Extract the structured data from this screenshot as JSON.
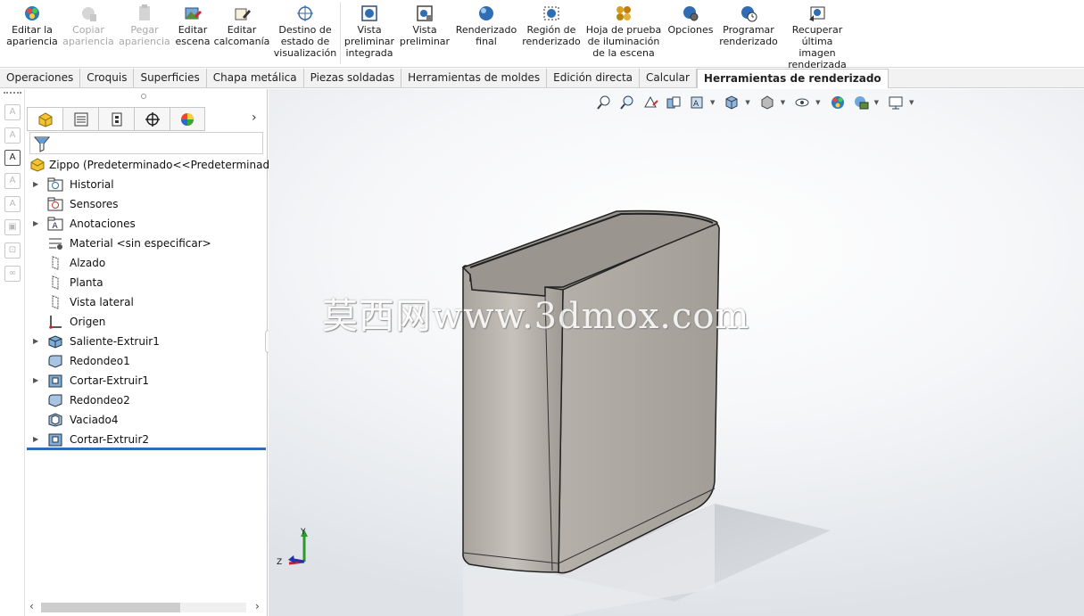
{
  "ribbon": {
    "buttons": [
      {
        "label": "Editar la\napariencia",
        "icon": "edit-appearance-icon",
        "enabled": true
      },
      {
        "label": "Copiar\napariencia",
        "icon": "copy-appearance-icon",
        "enabled": false
      },
      {
        "label": "Pegar\napariencia",
        "icon": "paste-appearance-icon",
        "enabled": false
      },
      {
        "label": "Editar\nescena",
        "icon": "edit-scene-icon",
        "enabled": true
      },
      {
        "label": "Editar\ncalcomanía",
        "icon": "edit-decal-icon",
        "enabled": true
      },
      {
        "label": "Destino de\nestado de\nvisualización",
        "icon": "display-state-target-icon",
        "enabled": true
      },
      {
        "label": "Vista\npreliminar\nintegrada",
        "icon": "integrated-preview-icon",
        "enabled": true
      },
      {
        "label": "Vista\npreliminar",
        "icon": "preview-window-icon",
        "enabled": true
      },
      {
        "label": "Renderizado\nfinal",
        "icon": "final-render-icon",
        "enabled": true
      },
      {
        "label": "Región de\nrenderizado",
        "icon": "render-region-icon",
        "enabled": true
      },
      {
        "label": "Hoja de prueba\nde iluminación\nde la escena",
        "icon": "scene-illumination-proof-sheet-icon",
        "enabled": true
      },
      {
        "label": "Opciones",
        "icon": "options-icon",
        "enabled": true
      },
      {
        "label": "Programar\nrenderizado",
        "icon": "schedule-render-icon",
        "enabled": true
      },
      {
        "label": "Recuperar\núltima imagen\nrenderizada",
        "icon": "recall-last-render-icon",
        "enabled": true
      }
    ]
  },
  "tabs": [
    {
      "label": "Operaciones",
      "active": false
    },
    {
      "label": "Croquis",
      "active": false
    },
    {
      "label": "Superficies",
      "active": false
    },
    {
      "label": "Chapa metálica",
      "active": false
    },
    {
      "label": "Piezas soldadas",
      "active": false
    },
    {
      "label": "Herramientas de moldes",
      "active": false
    },
    {
      "label": "Edición directa",
      "active": false
    },
    {
      "label": "Calcular",
      "active": false
    },
    {
      "label": "Herramientas de renderizado",
      "active": true
    }
  ],
  "panel": {
    "tabs": [
      "feature-manager-icon",
      "property-manager-icon",
      "configuration-manager-icon",
      "dimxpert-manager-icon",
      "display-manager-icon"
    ],
    "filter_icon": "filter-icon",
    "root": "Zippo  (Predeterminado<<Predeterminado>_P",
    "items": [
      {
        "label": "Historial",
        "icon": "history-folder-icon",
        "expandable": true
      },
      {
        "label": "Sensores",
        "icon": "sensors-folder-icon",
        "expandable": false
      },
      {
        "label": "Anotaciones",
        "icon": "annotations-folder-icon",
        "expandable": true
      },
      {
        "label": "Material <sin especificar>",
        "icon": "material-icon",
        "expandable": false
      },
      {
        "label": "Alzado",
        "icon": "plane-icon",
        "expandable": false
      },
      {
        "label": "Planta",
        "icon": "plane-icon",
        "expandable": false
      },
      {
        "label": "Vista lateral",
        "icon": "plane-icon",
        "expandable": false
      },
      {
        "label": "Origen",
        "icon": "origin-icon",
        "expandable": false
      },
      {
        "label": "Saliente-Extruir1",
        "icon": "boss-extrude-icon",
        "expandable": true
      },
      {
        "label": "Redondeo1",
        "icon": "fillet-icon",
        "expandable": false
      },
      {
        "label": "Cortar-Extruir1",
        "icon": "cut-extrude-icon",
        "expandable": true
      },
      {
        "label": "Redondeo2",
        "icon": "fillet-icon",
        "expandable": false
      },
      {
        "label": "Vaciado4",
        "icon": "shell-icon",
        "expandable": false
      },
      {
        "label": "Cortar-Extruir2",
        "icon": "cut-extrude-icon",
        "expandable": true
      }
    ]
  },
  "viewport": {
    "watermark": "莫西网www.3dmox.com",
    "triad": {
      "x": "",
      "y": "Y",
      "z": "Z"
    },
    "hud_icons": [
      "zoom-to-fit-icon",
      "zoom-to-area-icon",
      "previous-view-icon",
      "section-view-icon",
      "dynamic-annotation-view-icon",
      "view-orientation-icon",
      "display-style-icon",
      "hide-show-items-icon",
      "edit-appearance-icon",
      "apply-scene-icon",
      "view-settings-icon"
    ],
    "model_color": "#b8b3ab",
    "background_color": "#eef0f3"
  },
  "colors": {
    "accent": "#2f6db5",
    "tab_active_bg": "#ffffff",
    "ribbon_bg": "#ffffff"
  }
}
